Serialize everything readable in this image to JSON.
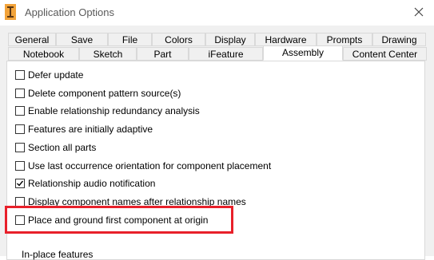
{
  "window": {
    "title": "Application Options"
  },
  "tabs_row1": [
    "General",
    "Save",
    "File",
    "Colors",
    "Display",
    "Hardware",
    "Prompts",
    "Drawing"
  ],
  "tabs_row2": [
    "Notebook",
    "Sketch",
    "Part",
    "iFeature",
    "Assembly",
    "Content Center"
  ],
  "active_tab": "Assembly",
  "options": [
    {
      "label": "Defer update",
      "checked": false
    },
    {
      "label": "Delete component pattern source(s)",
      "checked": false
    },
    {
      "label": "Enable relationship redundancy analysis",
      "checked": false
    },
    {
      "label": "Features are initially adaptive",
      "checked": false
    },
    {
      "label": "Section all parts",
      "checked": false
    },
    {
      "label": "Use last occurrence orientation for component placement",
      "checked": false
    },
    {
      "label": "Relationship audio notification",
      "checked": true
    },
    {
      "label": "Display component names after relationship names",
      "checked": false
    },
    {
      "label": "Place and ground first component at origin",
      "checked": false
    }
  ],
  "section_label": "In-place features",
  "colors": {
    "highlight": "#e8202a",
    "tab_border": "#d9d9d9",
    "chrome": "#f0f0f0"
  }
}
